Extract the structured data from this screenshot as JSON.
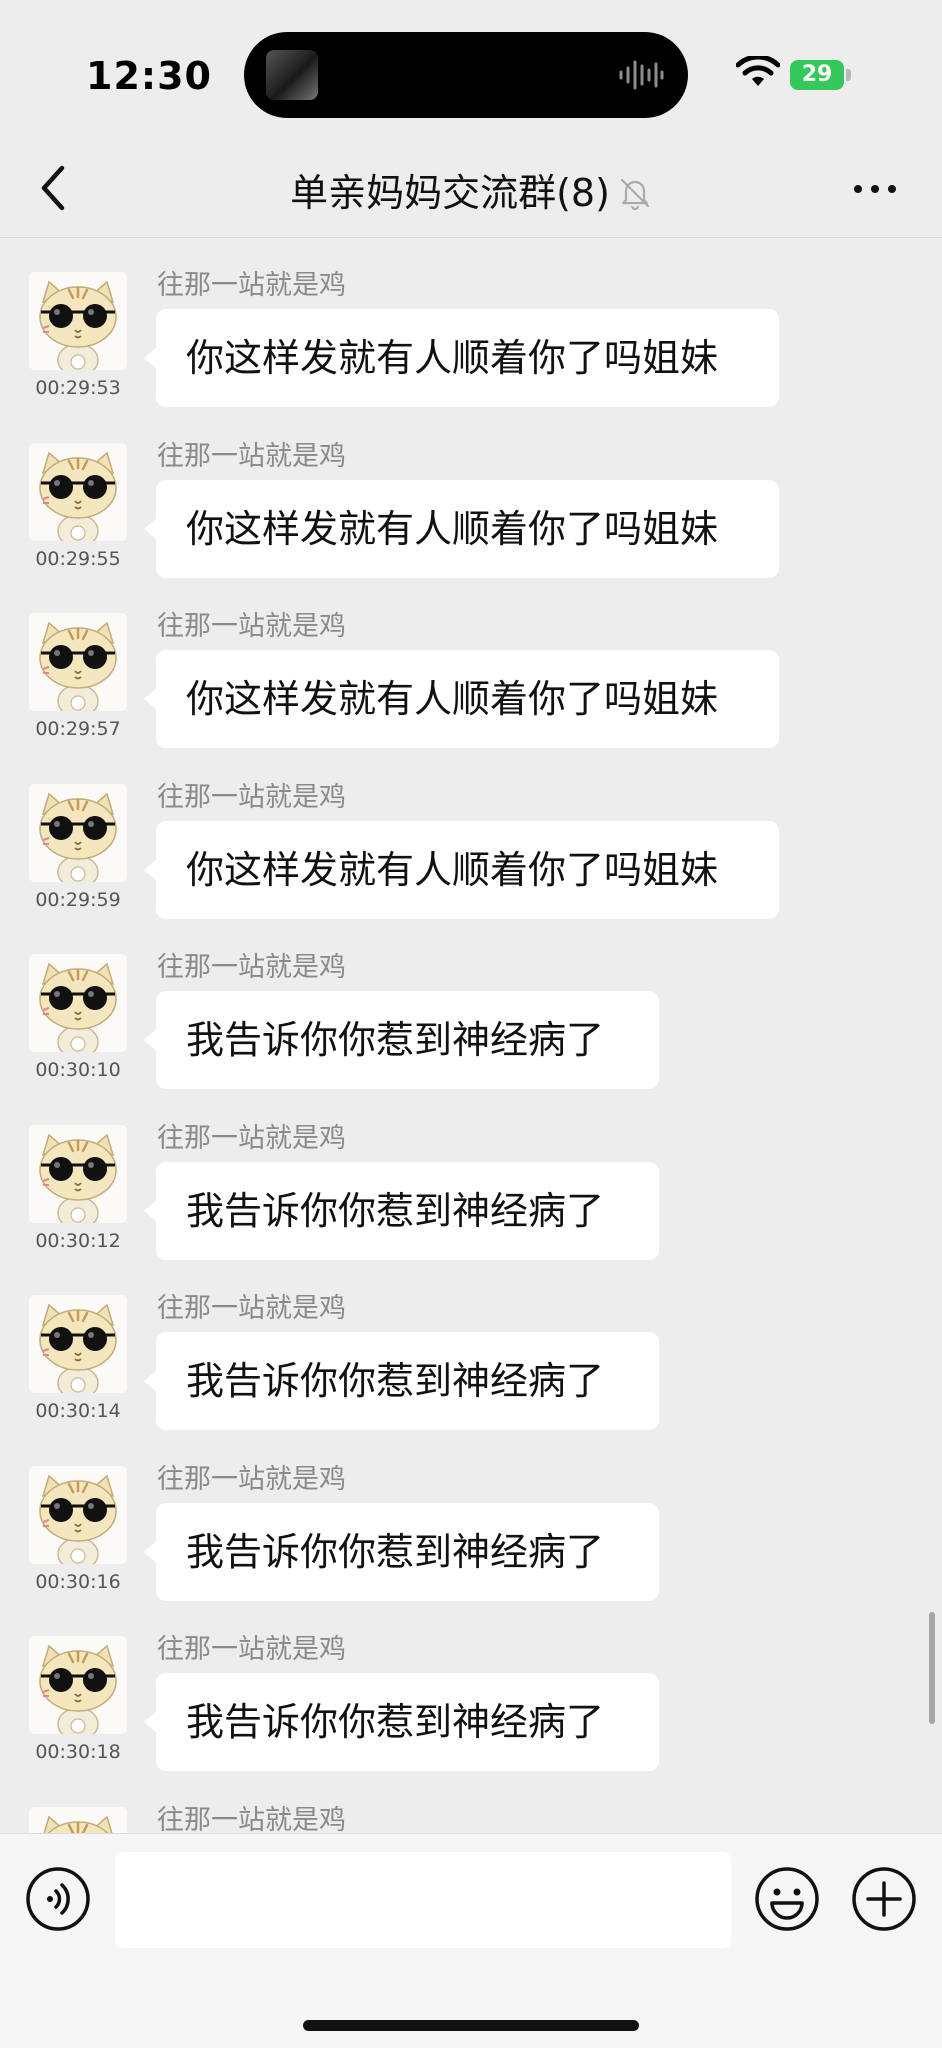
{
  "status_bar": {
    "time": "12:30",
    "battery": "29",
    "icons": [
      "now-playing-thumbnail",
      "audio-waveform-icon",
      "wifi-icon",
      "battery-charging-icon"
    ]
  },
  "nav": {
    "title": "单亲妈妈交流群(8)",
    "back_icon": "chevron-left-icon",
    "mute_icon": "bell-muted-icon",
    "more_icon": "more-dots-icon"
  },
  "messages": [
    {
      "sender": "往那一站就是鸡",
      "time": "00:29:53",
      "text": "你这样发就有人顺着你了吗姐妹"
    },
    {
      "sender": "往那一站就是鸡",
      "time": "00:29:55",
      "text": "你这样发就有人顺着你了吗姐妹"
    },
    {
      "sender": "往那一站就是鸡",
      "time": "00:29:57",
      "text": "你这样发就有人顺着你了吗姐妹"
    },
    {
      "sender": "往那一站就是鸡",
      "time": "00:29:59",
      "text": "你这样发就有人顺着你了吗姐妹"
    },
    {
      "sender": "往那一站就是鸡",
      "time": "00:30:10",
      "text": "我告诉你你惹到神经病了"
    },
    {
      "sender": "往那一站就是鸡",
      "time": "00:30:12",
      "text": "我告诉你你惹到神经病了"
    },
    {
      "sender": "往那一站就是鸡",
      "time": "00:30:14",
      "text": "我告诉你你惹到神经病了"
    },
    {
      "sender": "往那一站就是鸡",
      "time": "00:30:16",
      "text": "我告诉你你惹到神经病了"
    },
    {
      "sender": "往那一站就是鸡",
      "time": "00:30:18",
      "text": "我告诉你你惹到神经病了"
    },
    {
      "sender": "往那一站就是鸡",
      "time": "",
      "text": ""
    }
  ],
  "input_bar": {
    "placeholder": "",
    "value": "",
    "icons": [
      "voice-icon",
      "emoji-icon",
      "plus-icon"
    ]
  },
  "colors": {
    "background": "#ededed",
    "bubble": "#ffffff",
    "battery": "#34c759",
    "sender_name": "#8a8a8a"
  }
}
